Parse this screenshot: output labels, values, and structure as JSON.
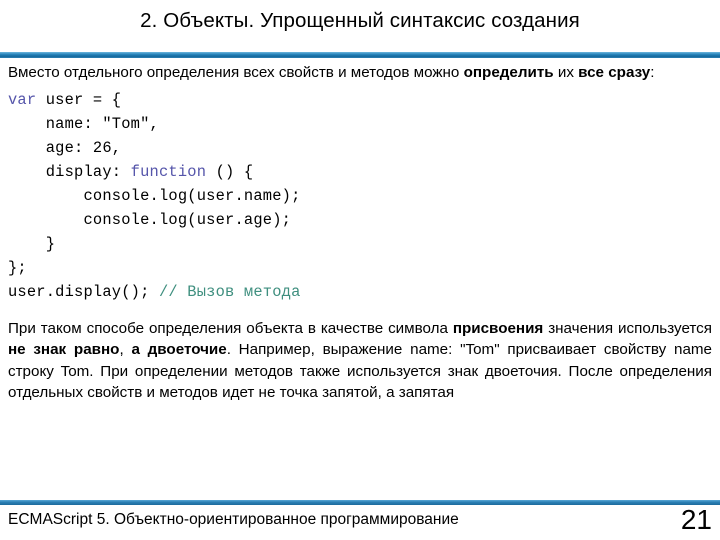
{
  "slide": {
    "title": "2. Объекты. Упрощенный синтаксис создания",
    "intro": {
      "part1": "Вместо отдельного определения всех свойств и методов можно ",
      "bold1": "определить",
      "part2": " их ",
      "bold2": "все сразу",
      "part3": ":"
    },
    "code": {
      "line1_kw": "var",
      "line1_rest": " user = {",
      "line2": "    name: \"Tom\",",
      "line3": "    age: 26,",
      "line4_a": "    display: ",
      "line4_kw": "function",
      "line4_b": " () {",
      "line5": "        console.log(user.name);",
      "line6": "        console.log(user.age);",
      "line7": "    }",
      "line8": "};",
      "line9_a": "user.display(); ",
      "line9_cmt": "// Вызов метода"
    },
    "outro": {
      "part1": "При таком способе определения объекта в качестве символа ",
      "bold1": "присвоения",
      "part2": " значения используется ",
      "bold2": "не знак равно",
      "part3": ", ",
      "bold3": "а двоеточие",
      "part4": ". Например, выражение name: \"Tom\" присваивает свойству name строку Tom. При определении методов также используется знак двоеточия. После определения отдельных свойств и методов идет не точка запятой, а запятая"
    },
    "footer": {
      "text": "ECMAScript 5. Объектно-ориентированное программирование",
      "page_number": "21"
    },
    "colors": {
      "divider": "#1d6a9c",
      "keyword": "#5555aa",
      "comment": "#3f8f7f",
      "text": "#000000",
      "background": "#ffffff"
    }
  }
}
